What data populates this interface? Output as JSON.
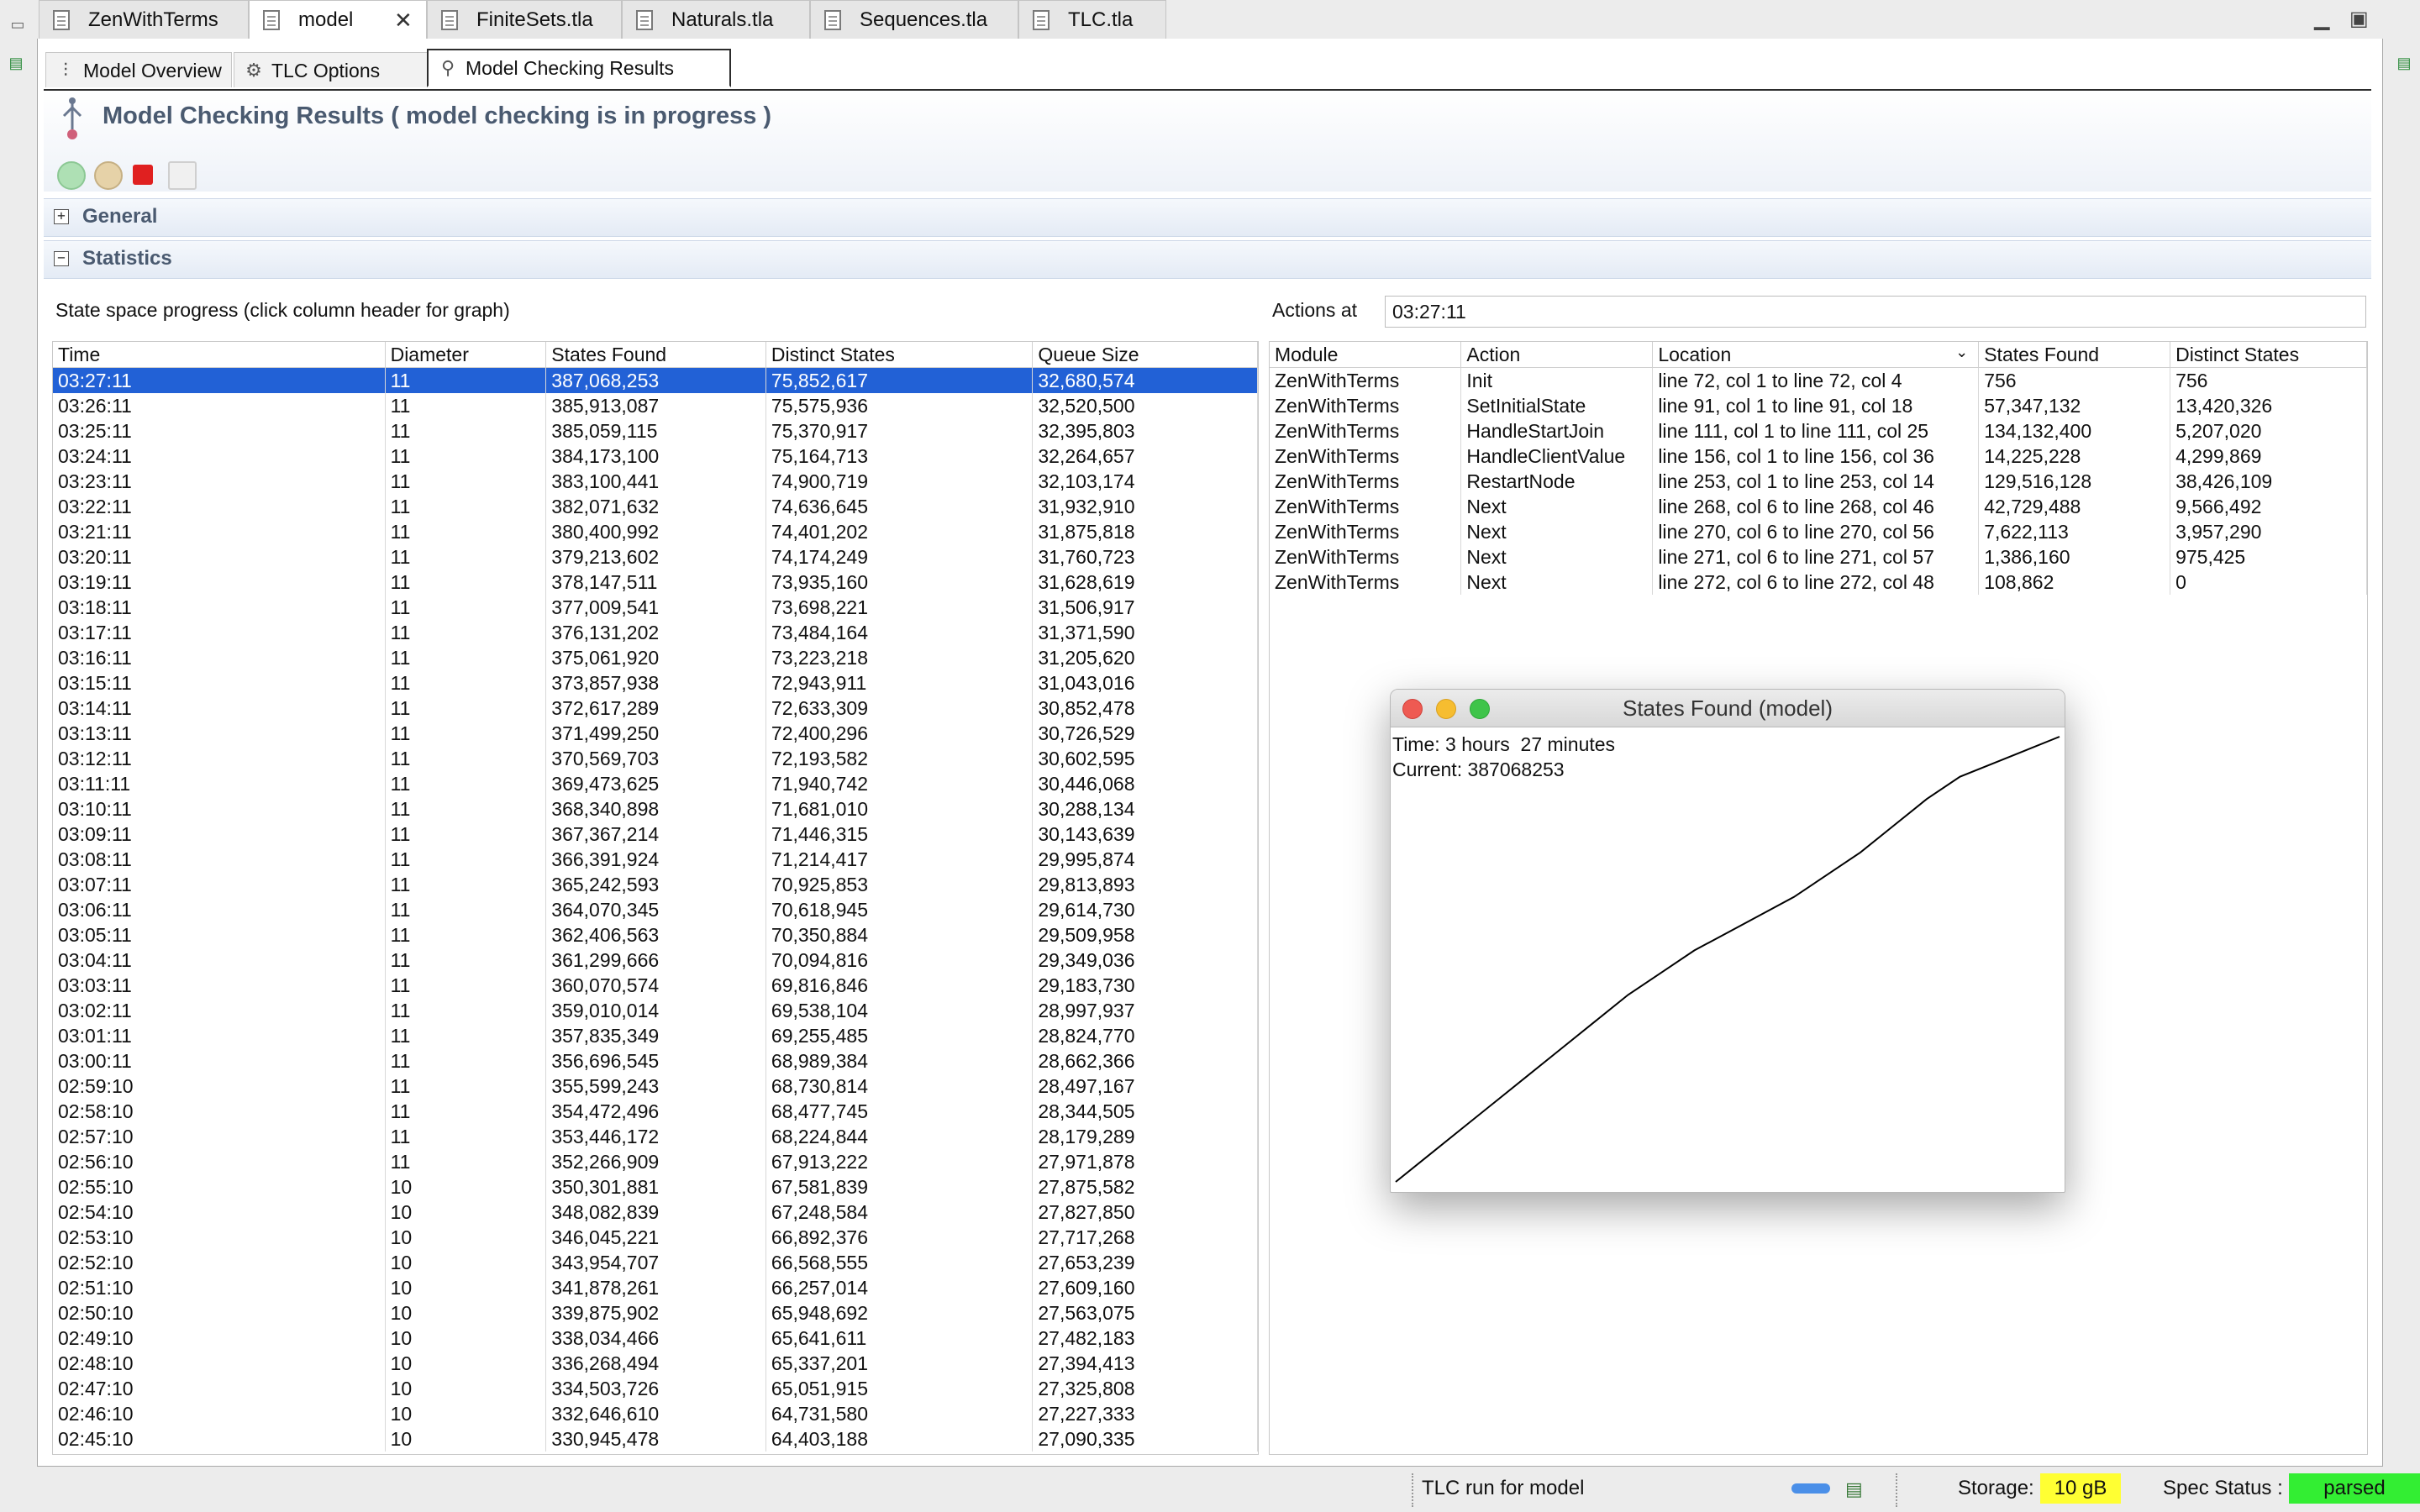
{
  "editor_tabs": [
    {
      "label": "ZenWithTerms",
      "active": false
    },
    {
      "label": "model",
      "active": true
    },
    {
      "label": "FiniteSets.tla",
      "active": false
    },
    {
      "label": "Naturals.tla",
      "active": false
    },
    {
      "label": "Sequences.tla",
      "active": false
    },
    {
      "label": "TLC.tla",
      "active": false
    }
  ],
  "page_tabs": [
    {
      "label": "Model Overview"
    },
    {
      "label": "TLC Options"
    },
    {
      "label": "Model Checking Results"
    }
  ],
  "header": {
    "title": "Model Checking Results ( model checking is in progress )"
  },
  "sections": {
    "general": "General",
    "statistics": "Statistics"
  },
  "progress": {
    "caption": "State space progress (click column header for graph)",
    "columns": [
      "Time",
      "Diameter",
      "States Found",
      "Distinct States",
      "Queue Size"
    ],
    "rows": [
      [
        "03:27:11",
        "11",
        "387,068,253",
        "75,852,617",
        "32,680,574"
      ],
      [
        "03:26:11",
        "11",
        "385,913,087",
        "75,575,936",
        "32,520,500"
      ],
      [
        "03:25:11",
        "11",
        "385,059,115",
        "75,370,917",
        "32,395,803"
      ],
      [
        "03:24:11",
        "11",
        "384,173,100",
        "75,164,713",
        "32,264,657"
      ],
      [
        "03:23:11",
        "11",
        "383,100,441",
        "74,900,719",
        "32,103,174"
      ],
      [
        "03:22:11",
        "11",
        "382,071,632",
        "74,636,645",
        "31,932,910"
      ],
      [
        "03:21:11",
        "11",
        "380,400,992",
        "74,401,202",
        "31,875,818"
      ],
      [
        "03:20:11",
        "11",
        "379,213,602",
        "74,174,249",
        "31,760,723"
      ],
      [
        "03:19:11",
        "11",
        "378,147,511",
        "73,935,160",
        "31,628,619"
      ],
      [
        "03:18:11",
        "11",
        "377,009,541",
        "73,698,221",
        "31,506,917"
      ],
      [
        "03:17:11",
        "11",
        "376,131,202",
        "73,484,164",
        "31,371,590"
      ],
      [
        "03:16:11",
        "11",
        "375,061,920",
        "73,223,218",
        "31,205,620"
      ],
      [
        "03:15:11",
        "11",
        "373,857,938",
        "72,943,911",
        "31,043,016"
      ],
      [
        "03:14:11",
        "11",
        "372,617,289",
        "72,633,309",
        "30,852,478"
      ],
      [
        "03:13:11",
        "11",
        "371,499,250",
        "72,400,296",
        "30,726,529"
      ],
      [
        "03:12:11",
        "11",
        "370,569,703",
        "72,193,582",
        "30,602,595"
      ],
      [
        "03:11:11",
        "11",
        "369,473,625",
        "71,940,742",
        "30,446,068"
      ],
      [
        "03:10:11",
        "11",
        "368,340,898",
        "71,681,010",
        "30,288,134"
      ],
      [
        "03:09:11",
        "11",
        "367,367,214",
        "71,446,315",
        "30,143,639"
      ],
      [
        "03:08:11",
        "11",
        "366,391,924",
        "71,214,417",
        "29,995,874"
      ],
      [
        "03:07:11",
        "11",
        "365,242,593",
        "70,925,853",
        "29,813,893"
      ],
      [
        "03:06:11",
        "11",
        "364,070,345",
        "70,618,945",
        "29,614,730"
      ],
      [
        "03:05:11",
        "11",
        "362,406,563",
        "70,350,884",
        "29,509,958"
      ],
      [
        "03:04:11",
        "11",
        "361,299,666",
        "70,094,816",
        "29,349,036"
      ],
      [
        "03:03:11",
        "11",
        "360,070,574",
        "69,816,846",
        "29,183,730"
      ],
      [
        "03:02:11",
        "11",
        "359,010,014",
        "69,538,104",
        "28,997,937"
      ],
      [
        "03:01:11",
        "11",
        "357,835,349",
        "69,255,485",
        "28,824,770"
      ],
      [
        "03:00:11",
        "11",
        "356,696,545",
        "68,989,384",
        "28,662,366"
      ],
      [
        "02:59:10",
        "11",
        "355,599,243",
        "68,730,814",
        "28,497,167"
      ],
      [
        "02:58:10",
        "11",
        "354,472,496",
        "68,477,745",
        "28,344,505"
      ],
      [
        "02:57:10",
        "11",
        "353,446,172",
        "68,224,844",
        "28,179,289"
      ],
      [
        "02:56:10",
        "11",
        "352,266,909",
        "67,913,222",
        "27,971,878"
      ],
      [
        "02:55:10",
        "10",
        "350,301,881",
        "67,581,839",
        "27,875,582"
      ],
      [
        "02:54:10",
        "10",
        "348,082,839",
        "67,248,584",
        "27,827,850"
      ],
      [
        "02:53:10",
        "10",
        "346,045,221",
        "66,892,376",
        "27,717,268"
      ],
      [
        "02:52:10",
        "10",
        "343,954,707",
        "66,568,555",
        "27,653,239"
      ],
      [
        "02:51:10",
        "10",
        "341,878,261",
        "66,257,014",
        "27,609,160"
      ],
      [
        "02:50:10",
        "10",
        "339,875,902",
        "65,948,692",
        "27,563,075"
      ],
      [
        "02:49:10",
        "10",
        "338,034,466",
        "65,641,611",
        "27,482,183"
      ],
      [
        "02:48:10",
        "10",
        "336,268,494",
        "65,337,201",
        "27,394,413"
      ],
      [
        "02:47:10",
        "10",
        "334,503,726",
        "65,051,915",
        "27,325,808"
      ],
      [
        "02:46:10",
        "10",
        "332,646,610",
        "64,731,580",
        "27,227,333"
      ],
      [
        "02:45:10",
        "10",
        "330,945,478",
        "64,403,188",
        "27,090,335"
      ]
    ]
  },
  "actions": {
    "label": "Actions at",
    "time": "03:27:11",
    "columns": [
      "Module",
      "Action",
      "Location",
      "States Found",
      "Distinct States"
    ],
    "rows": [
      [
        "ZenWithTerms",
        "Init",
        "line 72, col 1 to line 72, col 4",
        "756",
        "756"
      ],
      [
        "ZenWithTerms",
        "SetInitialState",
        "line 91, col 1 to line 91, col 18",
        "57,347,132",
        "13,420,326"
      ],
      [
        "ZenWithTerms",
        "HandleStartJoin",
        "line 111, col 1 to line 111, col 25",
        "134,132,400",
        "5,207,020"
      ],
      [
        "ZenWithTerms",
        "HandleClientValue",
        "line 156, col 1 to line 156, col 36",
        "14,225,228",
        "4,299,869"
      ],
      [
        "ZenWithTerms",
        "RestartNode",
        "line 253, col 1 to line 253, col 14",
        "129,516,128",
        "38,426,109"
      ],
      [
        "ZenWithTerms",
        "Next",
        "line 268, col 6 to line 268, col 46",
        "42,729,488",
        "9,566,492"
      ],
      [
        "ZenWithTerms",
        "Next",
        "line 270, col 6 to line 270, col 56",
        "7,622,113",
        "3,957,290"
      ],
      [
        "ZenWithTerms",
        "Next",
        "line 271, col 6 to line 271, col 57",
        "1,386,160",
        "975,425"
      ],
      [
        "ZenWithTerms",
        "Next",
        "line 272, col 6 to line 272, col 48",
        "108,862",
        "0"
      ]
    ]
  },
  "graph": {
    "title": "States Found (model)",
    "time_text": "Time: 3 hours  27 minutes",
    "current_text": "Current: 387068253"
  },
  "chart_data": {
    "type": "line",
    "title": "States Found (model)",
    "series": [
      {
        "name": "States Found",
        "values_fraction": [
          0.0,
          0.06,
          0.12,
          0.18,
          0.24,
          0.3,
          0.36,
          0.42,
          0.47,
          0.52,
          0.56,
          0.6,
          0.64,
          0.69,
          0.74,
          0.8,
          0.86,
          0.91,
          0.94,
          0.97,
          1.0
        ]
      }
    ],
    "grid": false,
    "colors": {
      "line": "#000000"
    }
  },
  "status": {
    "run_label": "TLC run for model",
    "storage_label": "Storage:",
    "storage_value": "10 gB",
    "spec_label": "Spec Status :",
    "spec_value": "parsed"
  },
  "colors": {
    "selection": "#2261d6",
    "storage_bg": "#ffff33",
    "spec_bg": "#33ee33",
    "header_text": "#4a5a70"
  }
}
